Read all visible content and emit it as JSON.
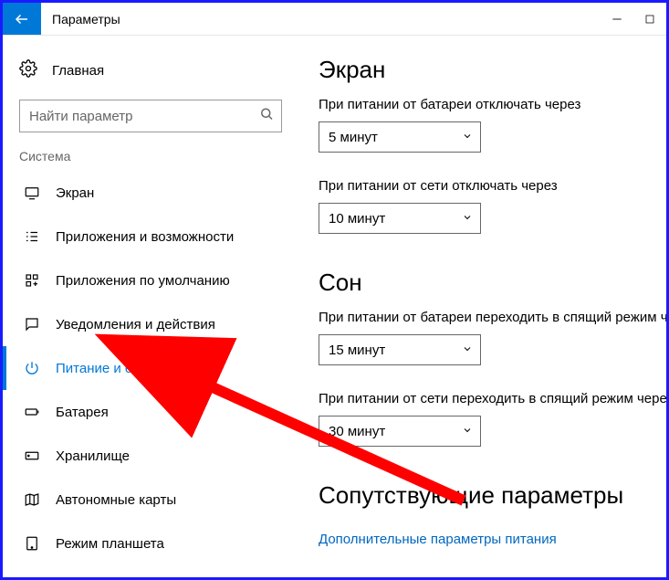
{
  "titlebar": {
    "title": "Параметры"
  },
  "sidebar": {
    "home": "Главная",
    "search_placeholder": "Найти параметр",
    "section": "Система",
    "items": [
      {
        "label": "Экран"
      },
      {
        "label": "Приложения и возможности"
      },
      {
        "label": "Приложения по умолчанию"
      },
      {
        "label": "Уведомления и действия"
      },
      {
        "label": "Питание и спящий режим"
      },
      {
        "label": "Батарея"
      },
      {
        "label": "Хранилище"
      },
      {
        "label": "Автономные карты"
      },
      {
        "label": "Режим планшета"
      }
    ]
  },
  "main": {
    "screen_heading": "Экран",
    "battery_off_label": "При питании от батареи отключать через",
    "battery_off_value": "5 минут",
    "plugged_off_label": "При питании от сети отключать через",
    "plugged_off_value": "10 минут",
    "sleep_heading": "Сон",
    "battery_sleep_label": "При питании от батареи переходить в спящий режим через",
    "battery_sleep_value": "15 минут",
    "plugged_sleep_label": "При питании от сети переходить в спящий режим через",
    "plugged_sleep_value": "30 минут",
    "related_heading": "Сопутствующие параметры",
    "related_link": "Дополнительные параметры питания"
  }
}
